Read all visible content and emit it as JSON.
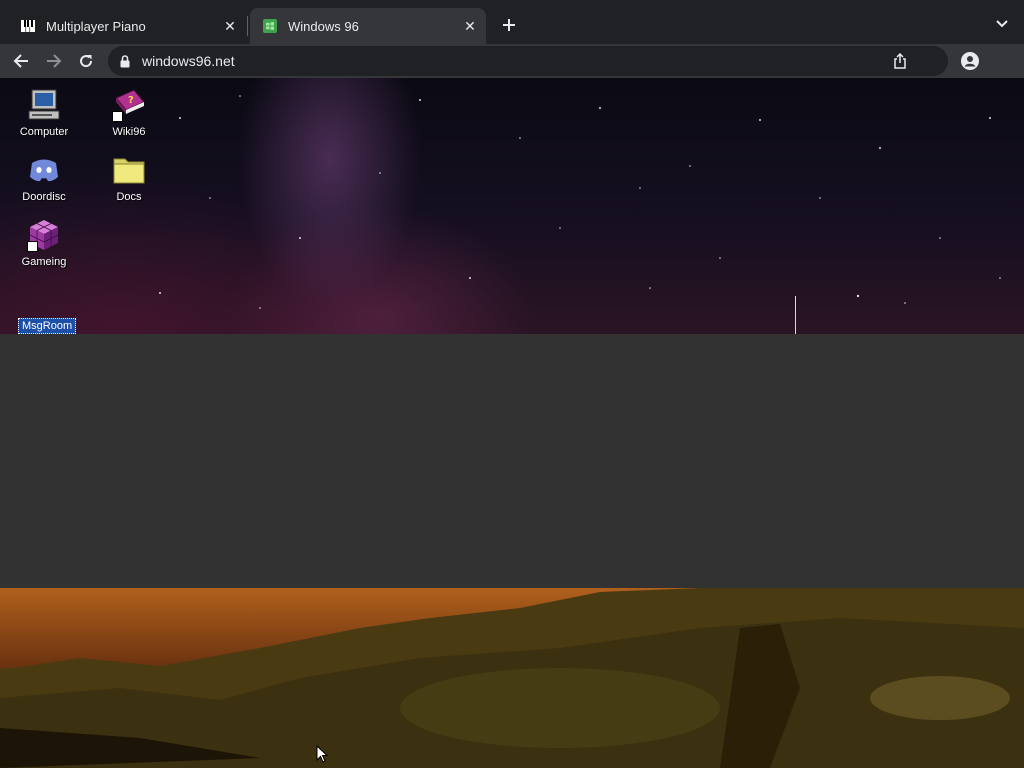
{
  "tabs": [
    {
      "title": "Multiplayer Piano",
      "favicon": "piano-icon",
      "active": false
    },
    {
      "title": "Windows 96",
      "favicon": "windows96-icon",
      "active": true
    }
  ],
  "toolbar": {
    "url": "windows96.net"
  },
  "desktop": {
    "icons": [
      {
        "label": "Computer",
        "icon": "computer-icon"
      },
      {
        "label": "Wiki96",
        "icon": "book-help-icon"
      },
      {
        "label": "Doordisc",
        "icon": "discord-icon"
      },
      {
        "label": "Docs",
        "icon": "folder-icon"
      },
      {
        "label": "Gameing",
        "icon": "cube-icon"
      }
    ],
    "selected_label": "MsgRoom"
  },
  "colors": {
    "tabstrip_bg": "#202124",
    "toolbar_bg": "#35363a",
    "omnibox_bg": "#202124",
    "gap_bg": "#323232",
    "selection_bg": "#1c4fa8"
  }
}
